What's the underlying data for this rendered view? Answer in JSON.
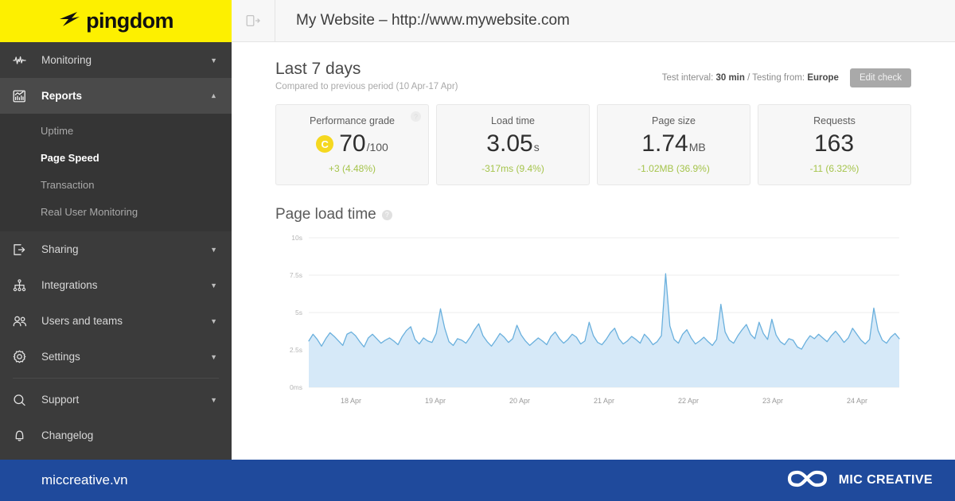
{
  "brand": {
    "logo_text": "pingdom",
    "logo_icon": "pingdom-swoosh-icon",
    "yellow": "#fdf000"
  },
  "sidebar": {
    "items": [
      {
        "label": "Monitoring",
        "icon": "pulse-icon",
        "chevron": "chevron-down-icon",
        "active": false
      },
      {
        "label": "Reports",
        "icon": "report-chart-icon",
        "chevron": "chevron-up-icon",
        "active": true
      },
      {
        "label": "Sharing",
        "icon": "share-export-icon",
        "chevron": "chevron-down-icon",
        "active": false
      },
      {
        "label": "Integrations",
        "icon": "sitemap-icon",
        "chevron": "chevron-down-icon",
        "active": false
      },
      {
        "label": "Users and teams",
        "icon": "users-icon",
        "chevron": "chevron-down-icon",
        "active": false
      },
      {
        "label": "Settings",
        "icon": "gear-icon",
        "chevron": "chevron-down-icon",
        "active": false
      },
      {
        "label": "Support",
        "icon": "chat-bubble-icon",
        "chevron": "chevron-down-icon",
        "active": false
      },
      {
        "label": "Changelog",
        "icon": "bell-icon",
        "chevron": "",
        "active": false
      }
    ],
    "reports_subitems": [
      {
        "label": "Uptime",
        "active": false
      },
      {
        "label": "Page Speed",
        "active": true
      },
      {
        "label": "Transaction",
        "active": false
      },
      {
        "label": "Real User Monitoring",
        "active": false
      }
    ]
  },
  "header": {
    "collapse_icon": "sidebar-expand-icon",
    "title": "My Website – http://www.mywebsite.com"
  },
  "summary": {
    "period_title": "Last 7 days",
    "period_subtitle": "Compared to previous period (10 Apr-17 Apr)",
    "meta_prefix": "Test interval: ",
    "meta_interval": "30 min",
    "meta_middle": " / Testing from: ",
    "meta_location": "Europe",
    "edit_button": "Edit check"
  },
  "cards": [
    {
      "label": "Performance grade",
      "grade": "C",
      "value": "70",
      "unit": "/100",
      "delta": "+3 (4.48%)",
      "help": "?",
      "has_help": true,
      "has_grade": true
    },
    {
      "label": "Load time",
      "grade": "",
      "value": "3.05",
      "unit": "s",
      "delta": "-317ms (9.4%)",
      "help": "",
      "has_help": false,
      "has_grade": false
    },
    {
      "label": "Page size",
      "grade": "",
      "value": "1.74",
      "unit": "MB",
      "delta": "-1.02MB (36.9%)",
      "help": "",
      "has_help": false,
      "has_grade": false
    },
    {
      "label": "Requests",
      "grade": "",
      "value": "163",
      "unit": "",
      "delta": "-11 (6.32%)",
      "help": "",
      "has_help": false,
      "has_grade": false
    }
  ],
  "chart_header": {
    "title": "Page load time",
    "help": "?"
  },
  "chart_data": {
    "type": "area",
    "title": "Page load time",
    "xlabel": "",
    "ylabel": "",
    "ylim": [
      0,
      10
    ],
    "ytick_labels": [
      "10s",
      "7.5s",
      "5s",
      "2.5s",
      "0ms"
    ],
    "ytick_values": [
      10,
      7.5,
      5,
      2.5,
      0
    ],
    "xtick_labels": [
      "18 Apr",
      "19 Apr",
      "20 Apr",
      "21 Apr",
      "22 Apr",
      "23 Apr",
      "24 Apr"
    ],
    "grid": true,
    "legend": "none",
    "line_color": "#6ab0dd",
    "fill_color": "#d6e9f8",
    "series": [
      {
        "name": "Page load time",
        "unit": "s",
        "values": [
          3.1,
          3.55,
          3.2,
          2.75,
          3.25,
          3.65,
          3.4,
          3.1,
          2.8,
          3.55,
          3.7,
          3.45,
          3.05,
          2.7,
          3.3,
          3.55,
          3.25,
          2.95,
          3.15,
          3.3,
          3.1,
          2.85,
          3.4,
          3.8,
          4.05,
          3.2,
          2.9,
          3.3,
          3.1,
          3.0,
          3.6,
          5.25,
          3.95,
          3.05,
          2.8,
          3.25,
          3.15,
          2.95,
          3.35,
          3.85,
          4.25,
          3.45,
          3.05,
          2.75,
          3.15,
          3.6,
          3.35,
          3.0,
          3.25,
          4.15,
          3.5,
          3.1,
          2.8,
          3.05,
          3.3,
          3.1,
          2.85,
          3.4,
          3.7,
          3.25,
          2.95,
          3.2,
          3.55,
          3.35,
          2.9,
          3.1,
          4.35,
          3.45,
          3.0,
          2.85,
          3.2,
          3.65,
          3.95,
          3.25,
          2.9,
          3.1,
          3.4,
          3.2,
          2.95,
          3.55,
          3.25,
          2.85,
          3.05,
          3.45,
          7.6,
          4.1,
          3.2,
          2.95,
          3.55,
          3.85,
          3.3,
          2.9,
          3.1,
          3.35,
          3.05,
          2.8,
          3.2,
          5.55,
          3.7,
          3.15,
          2.95,
          3.45,
          3.85,
          4.2,
          3.55,
          3.25,
          4.35,
          3.6,
          3.2,
          4.55,
          3.5,
          3.05,
          2.85,
          3.25,
          3.15,
          2.7,
          2.55,
          3.05,
          3.45,
          3.25,
          3.55,
          3.3,
          3.05,
          3.45,
          3.75,
          3.4,
          3.0,
          3.3,
          3.95,
          3.55,
          3.15,
          2.9,
          3.2,
          5.3,
          3.8,
          3.15,
          2.95,
          3.35,
          3.6,
          3.25
        ]
      }
    ]
  },
  "banner": {
    "url": "miccreative.vn",
    "brand_name": "MIC CREATIVE",
    "logo_icon": "mic-creative-infinity-icon",
    "background": "#1f4a9c"
  }
}
